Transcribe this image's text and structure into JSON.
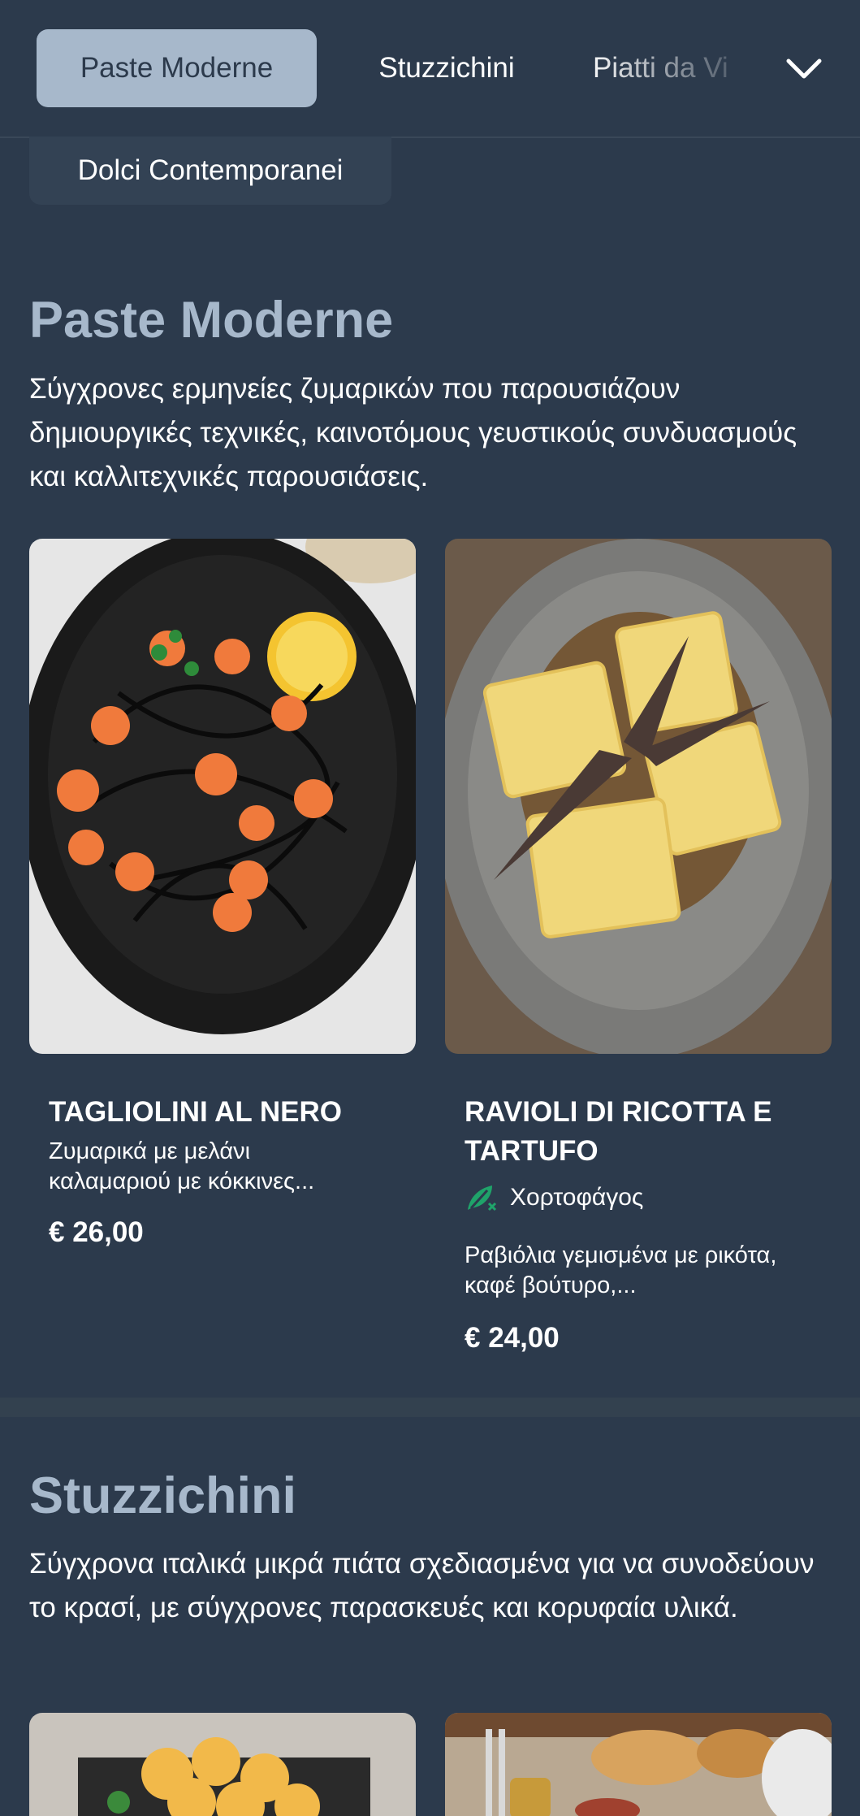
{
  "nav": {
    "tabs": [
      {
        "label": "Paste Moderne",
        "active": true
      },
      {
        "label": "Stuzzichini",
        "active": false
      },
      {
        "label": "Piatti da Vi",
        "active": false
      },
      {
        "label": "Dolci Contemporanei",
        "active": false
      }
    ],
    "expand_icon": "chevron-down-icon"
  },
  "sections": [
    {
      "title": "Paste Moderne",
      "description": "Σύγχρονες ερμηνείες ζυμαρικών που παρουσιάζουν δημιουργικές τεχνικές, καινοτόμους γευστικούς συνδυασμούς και καλλιτεχνικές παρουσιάσεις.",
      "items": [
        {
          "name": "TAGLIOLINI AL NERO",
          "description": "Ζυμαρικά με μελάνι καλαμαριού με κόκκινες...",
          "price": "€ 26,00",
          "image": "squid-ink-pasta-with-shrimp-photo"
        },
        {
          "name": "RAVIOLI DI RICOTTA E TARTUFO",
          "tag": "Χορτοφάγος",
          "tag_icon": "vegetarian-leaf-icon",
          "description": "Ραβιόλια γεμισμένα με ρικότα, καφέ βούτυρο,...",
          "price": "€ 24,00",
          "image": "ravioli-with-truffle-and-sage-photo"
        }
      ]
    },
    {
      "title": "Stuzzichini",
      "description": "Σύγχρονα ιταλικά μικρά πιάτα σχεδιασμένα για να συνοδεύουν το κρασί, με σύγχρονες παρασκευές και κορυφαία υλικά.",
      "items": [
        {
          "image": "parmesan-crisps-photo"
        },
        {
          "image": "bruschetta-board-photo"
        }
      ]
    }
  ],
  "colors": {
    "background": "#2c3a4c",
    "accent": "#a7b8cb",
    "veg_green": "#1fa36a"
  }
}
